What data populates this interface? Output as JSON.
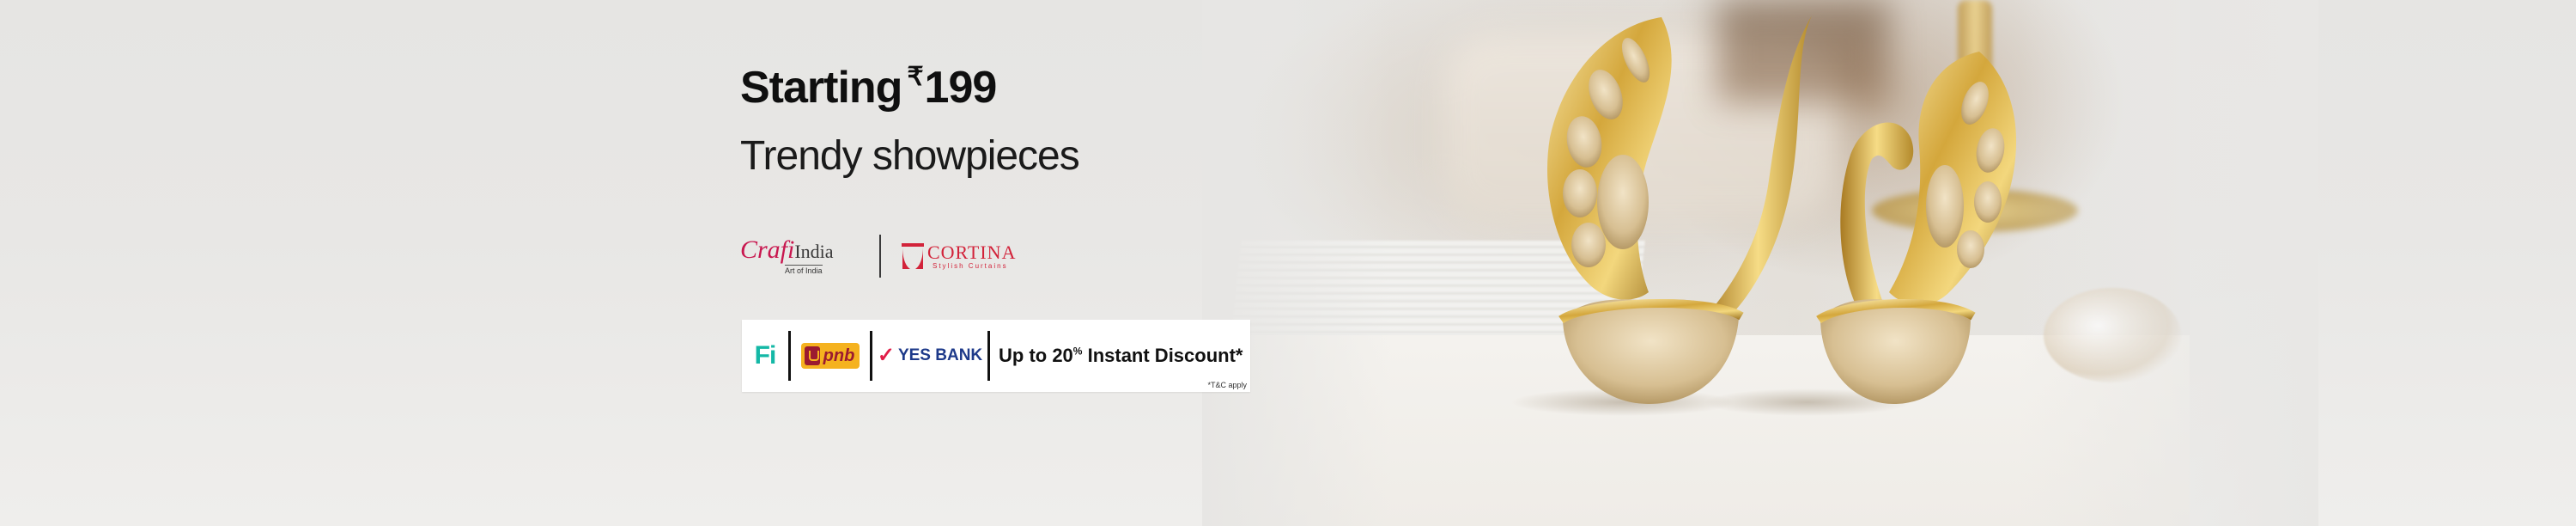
{
  "banner": {
    "headline_prefix": "Starting",
    "headline_currency": "₹",
    "headline_price": "199",
    "subline": "Trendy showpieces"
  },
  "brands": {
    "crafi_script": "Crafi",
    "crafi_india": "India",
    "crafi_tagline": "Art of India",
    "cortina_name": "CORTINA",
    "cortina_tagline": "Stylish Curtains"
  },
  "offer": {
    "fi_logo": "Fi",
    "pnb_logo": "pnb",
    "yes_logo": "YES BANK",
    "discount_prefix": "Up to 20",
    "discount_percent_sign": "%",
    "discount_suffix": " Instant Discount*",
    "tnc": "*T&C apply"
  },
  "colors": {
    "fi_teal": "#14b8a6",
    "pnb_yellow": "#f5b21f",
    "pnb_maroon": "#9b1b30",
    "yes_blue": "#1e3a8a",
    "crafi_pink": "#c8174f",
    "cortina_red": "#d2233a",
    "gold": "#d4a73c"
  },
  "icons": {
    "crafi": "crafi-india-logo",
    "cortina": "cortina-logo",
    "fi": "fi-bank-logo",
    "pnb": "pnb-logo",
    "yes": "yes-bank-logo",
    "product": "gold-swan-showpiece-pair"
  }
}
